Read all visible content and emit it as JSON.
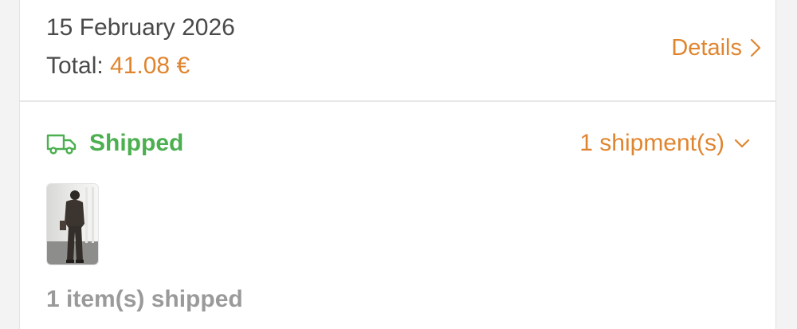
{
  "order": {
    "date": "15 February 2026",
    "total_label": "Total: ",
    "total_amount": "41.08 €",
    "details_label": "Details"
  },
  "shipment": {
    "status_label": "Shipped",
    "status_icon": "truck-icon",
    "shipments_count_label": "1 shipment(s)",
    "items_shipped_label": "1 item(s) shipped",
    "product_thumbnail": "product-photo"
  },
  "colors": {
    "accent": "#e0852f",
    "status_shipped": "#4caf50",
    "text_primary": "#4a4a4a",
    "text_muted": "#9a9a9a",
    "divider": "#e6e6e6"
  }
}
